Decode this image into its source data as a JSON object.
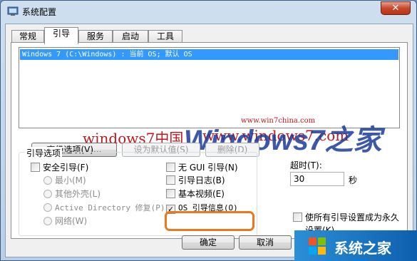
{
  "window": {
    "title": "系统配置",
    "close_glyph": "✕"
  },
  "tabs": [
    {
      "label": "常规",
      "active": false
    },
    {
      "label": "引导",
      "active": true
    },
    {
      "label": "服务",
      "active": false
    },
    {
      "label": "启动",
      "active": false
    },
    {
      "label": "工具",
      "active": false
    }
  ],
  "boot_list": {
    "items": [
      "Windows 7 (C:\\Windows) : 当前 OS; 默认 OS"
    ]
  },
  "buttons": {
    "advanced": "高级选项(V)...",
    "set_default": "设为默认值(S)",
    "delete": "删除(D)"
  },
  "boot_options": {
    "legend": "引导选项",
    "safe_boot": "安全引导(F)",
    "minimal": "最小(M)",
    "alternate_shell": "其他外壳(L)",
    "active_directory": "Active Directory 修复(P)",
    "network": "网络(W)",
    "no_gui": "无 GUI 引导(N)",
    "boot_log": "引导日志(B)",
    "base_video": "基本视频(E)",
    "os_boot_info": "OS 引导信息(O)",
    "os_boot_info_checked": true
  },
  "timeout": {
    "label": "超时(T):",
    "value": "30",
    "unit": "秒"
  },
  "persistent": {
    "label_line1": "使所有引导设置成为永久",
    "label_line2": "设置(K)"
  },
  "dialog_buttons": {
    "ok": "确定",
    "cancel": "取消"
  },
  "watermark": {
    "url": "www.win7china.com",
    "text": "windows7中国",
    "site": "www.windows7.com",
    "logo_big": "Windows7之家",
    "bottom_brand": "系统之家"
  },
  "colors": {
    "selection": "#3399ff",
    "highlight_ring": "#e8791f",
    "watermark_red": "#c0161e",
    "logo_blue": "#1a3d9a"
  }
}
